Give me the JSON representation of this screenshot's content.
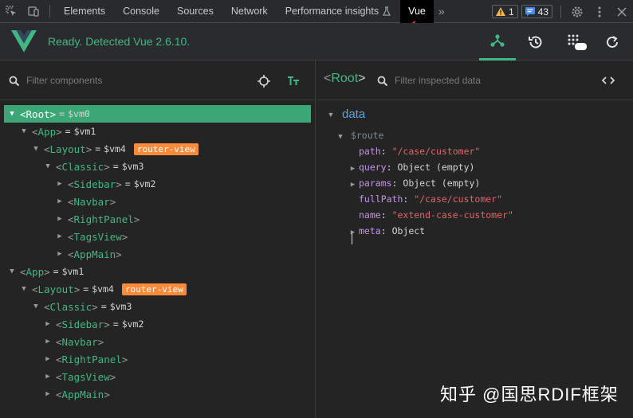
{
  "devtools": {
    "tabs": [
      "Elements",
      "Console",
      "Sources",
      "Network",
      "Performance insights",
      "Vue"
    ],
    "active_tab": "Vue",
    "warnings_count": "1",
    "messages_count": "43"
  },
  "vue_header": {
    "status": "Ready. Detected Vue 2.6.10."
  },
  "left_pane": {
    "filter_placeholder": "Filter components",
    "tree": [
      {
        "depth": 0,
        "expanded": true,
        "name": "Root",
        "vm": "$vm0",
        "badge": "",
        "selected": true
      },
      {
        "depth": 1,
        "expanded": true,
        "name": "App",
        "vm": "$vm1",
        "badge": "",
        "selected": false
      },
      {
        "depth": 2,
        "expanded": true,
        "name": "Layout",
        "vm": "$vm4",
        "badge": "router-view",
        "selected": false
      },
      {
        "depth": 3,
        "expanded": true,
        "name": "Classic",
        "vm": "$vm3",
        "badge": "",
        "selected": false
      },
      {
        "depth": 4,
        "expanded": false,
        "name": "Sidebar",
        "vm": "$vm2",
        "badge": "",
        "selected": false
      },
      {
        "depth": 4,
        "expanded": false,
        "name": "Navbar",
        "vm": "",
        "badge": "",
        "selected": false
      },
      {
        "depth": 4,
        "expanded": false,
        "name": "RightPanel",
        "vm": "",
        "badge": "",
        "selected": false
      },
      {
        "depth": 4,
        "expanded": false,
        "name": "TagsView",
        "vm": "",
        "badge": "",
        "selected": false
      },
      {
        "depth": 4,
        "expanded": false,
        "name": "AppMain",
        "vm": "",
        "badge": "",
        "selected": false
      },
      {
        "depth": 0,
        "expanded": true,
        "name": "App",
        "vm": "$vm1",
        "badge": "",
        "selected": false
      },
      {
        "depth": 1,
        "expanded": true,
        "name": "Layout",
        "vm": "$vm4",
        "badge": "router-view",
        "selected": false
      },
      {
        "depth": 2,
        "expanded": true,
        "name": "Classic",
        "vm": "$vm3",
        "badge": "",
        "selected": false
      },
      {
        "depth": 3,
        "expanded": false,
        "name": "Sidebar",
        "vm": "$vm2",
        "badge": "",
        "selected": false
      },
      {
        "depth": 3,
        "expanded": false,
        "name": "Navbar",
        "vm": "",
        "badge": "",
        "selected": false
      },
      {
        "depth": 3,
        "expanded": false,
        "name": "RightPanel",
        "vm": "",
        "badge": "",
        "selected": false
      },
      {
        "depth": 3,
        "expanded": false,
        "name": "TagsView",
        "vm": "",
        "badge": "",
        "selected": false
      },
      {
        "depth": 3,
        "expanded": false,
        "name": "AppMain",
        "vm": "",
        "badge": "",
        "selected": false
      }
    ]
  },
  "right_pane": {
    "inspected": "Root",
    "filter_placeholder": "Filter inspected data",
    "section": "data",
    "group": "$route",
    "props": [
      {
        "key": "path",
        "value": "\"/case/customer\"",
        "type": "string",
        "expandable": false
      },
      {
        "key": "query",
        "value": "Object (empty)",
        "type": "object",
        "expandable": true
      },
      {
        "key": "params",
        "value": "Object (empty)",
        "type": "object",
        "expandable": true
      },
      {
        "key": "fullPath",
        "value": "\"/case/customer\"",
        "type": "string",
        "expandable": false
      },
      {
        "key": "name",
        "value": "\"extend-case-customer\"",
        "type": "string",
        "expandable": false
      },
      {
        "key": "meta",
        "value": "Object",
        "type": "object",
        "expandable": true
      }
    ]
  },
  "watermark": "知乎 @国思RDIF框架",
  "colors": {
    "vue_green": "#41b883",
    "badge_orange": "#ff8a3a",
    "selected_bg": "#3ba776"
  }
}
